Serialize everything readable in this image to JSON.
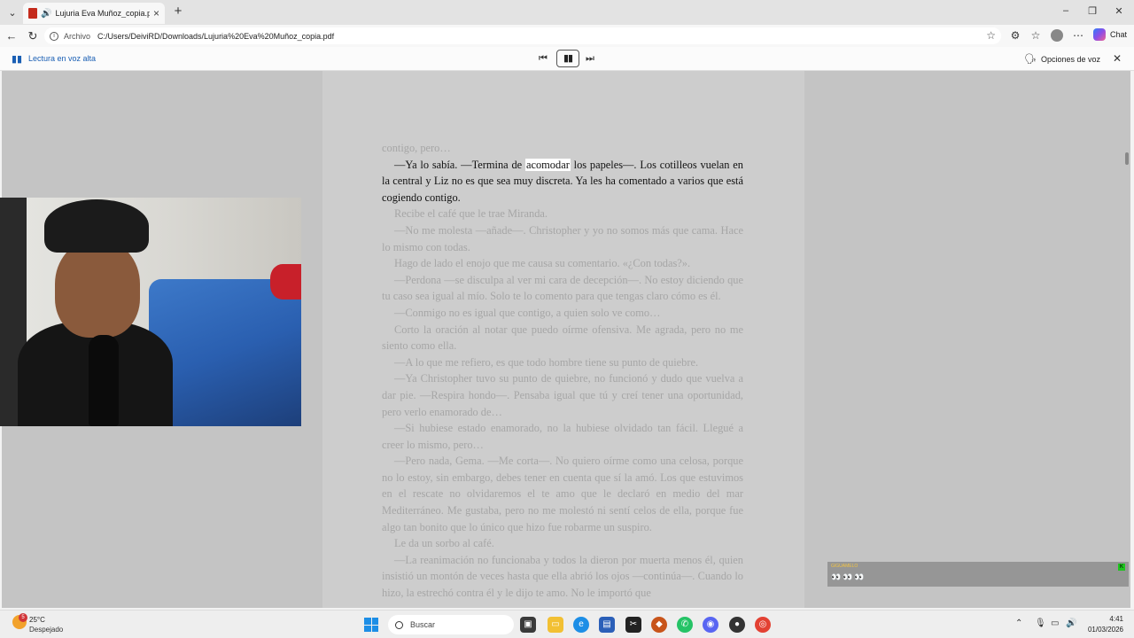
{
  "browser": {
    "tab_title": "Lujuria Eva Muñoz_copia.pdf",
    "address_prefix": "Archivo",
    "url": "C:/Users/DeiviRD/Downloads/Lujuria%20Eva%20Muñoz_copia.pdf",
    "chat_label": "Chat"
  },
  "read_aloud": {
    "label": "Lectura en voz alta",
    "voice_options": "Opciones de voz"
  },
  "document": {
    "paragraphs": [
      {
        "text": "contigo, pero…",
        "indent": false
      },
      {
        "before": "—Ya lo sabía. —Termina de ",
        "highlight": "acomodar",
        "after": " los papeles—. Los cotilleos vuelan en la central y Liz no es que sea muy discreta. Ya les ha comentado a varios que está cogiendo contigo.",
        "current": true
      },
      {
        "text": "Recibe el café que le trae Miranda."
      },
      {
        "text": "—No me molesta —añade—. Christopher y yo no somos más que cama. Hace lo mismo con todas."
      },
      {
        "text": "Hago de lado el enojo que me causa su comentario. «¿Con todas?»."
      },
      {
        "text": "—Perdona —se disculpa al ver mi cara de decepción—. No estoy diciendo que tu caso sea igual al mío. Solo te lo comento para que tengas claro cómo es él."
      },
      {
        "text": "—Conmigo no es igual que contigo, a quien solo ve como…"
      },
      {
        "text": "Corto la oración al notar que puedo oírme ofensiva. Me agrada, pero no me siento como ella."
      },
      {
        "text": "—A lo que me refiero, es que todo hombre tiene su punto de quiebre."
      },
      {
        "text": "—Ya Christopher tuvo su punto de quiebre, no funcionó y dudo que vuelva a dar pie. —Respira hondo—. Pensaba igual que tú y creí tener una oportunidad, pero verlo enamorado de…"
      },
      {
        "text": "—Si hubiese estado enamorado, no la hubiese olvidado tan fácil. Llegué a creer lo mismo, pero…"
      },
      {
        "text": "—Pero nada, Gema. —Me corta—. No quiero oírme como una celosa, porque no lo estoy, sin embargo, debes tener en cuenta que sí la amó. Los que estuvimos en el rescate no olvidaremos el te amo que le declaró en medio del mar Mediterráneo. Me gustaba, pero no me molestó ni sentí celos de ella, porque fue algo tan bonito que lo único que hizo fue robarme un suspiro."
      },
      {
        "text": "Le da un sorbo al café."
      },
      {
        "text": "—La reanimación no funcionaba y todos la dieron por muerta menos él, quien insistió un montón de veces hasta que ella abrió los ojos —continúa—. Cuando lo hizo, la estrechó contra él y le dijo te amo. No le importó que"
      }
    ]
  },
  "chat_widget": {
    "username": "GIGUAMELO",
    "message": "👀👀👀",
    "badge": "K"
  },
  "taskbar": {
    "weather_temp": "25°C",
    "weather_desc": "Despejado",
    "weather_badge": "5",
    "search_placeholder": "Buscar",
    "time": "4:41",
    "date": "01/03/2026"
  },
  "colors": {
    "accent": "#1a5fb4",
    "pdf_red": "#c42b1c",
    "windows_blue": "#1d8ee6"
  }
}
